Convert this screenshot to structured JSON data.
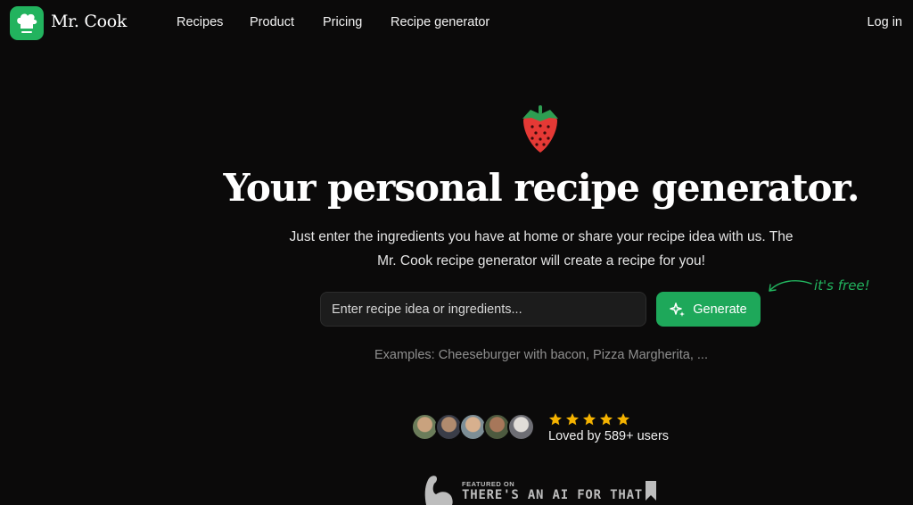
{
  "header": {
    "brand": "Mr. Cook",
    "nav": [
      "Recipes",
      "Product",
      "Pricing",
      "Recipe generator"
    ],
    "login": "Log in"
  },
  "hero": {
    "title": "Your personal recipe generator.",
    "subtitle_line1": "Just enter the ingredients you have at home or share your recipe idea with us. The",
    "subtitle_line2": "Mr. Cook recipe generator will create a recipe for you!",
    "input_placeholder": "Enter recipe idea or ingredients...",
    "button_label": "Generate",
    "free_note": "it's free!",
    "examples": "Examples: Cheeseburger with bacon, Pizza Margherita, ..."
  },
  "social": {
    "rating_stars": 5,
    "loved_text": "Loved by 589+ users"
  },
  "featured": {
    "small": "FEATURED ON",
    "big": "THERE'S AN AI FOR THAT"
  },
  "colors": {
    "background": "#0b0a0a",
    "accent_green": "#1ea85a",
    "star": "#f5b300",
    "strawberry": "#e53935"
  }
}
